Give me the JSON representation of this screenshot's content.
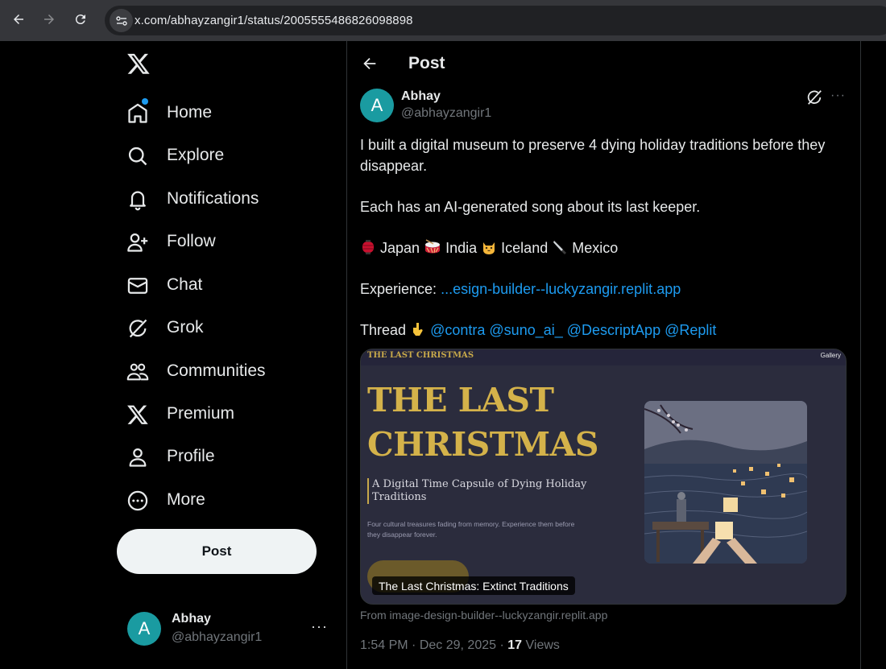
{
  "browser": {
    "url": "x.com/abhayzangir1/status/2005555486826098898"
  },
  "nav": {
    "items": [
      {
        "label": "Home",
        "icon": "home-icon"
      },
      {
        "label": "Explore",
        "icon": "search-icon"
      },
      {
        "label": "Notifications",
        "icon": "bell-icon"
      },
      {
        "label": "Follow",
        "icon": "person-add-icon"
      },
      {
        "label": "Chat",
        "icon": "envelope-icon"
      },
      {
        "label": "Grok",
        "icon": "grok-icon"
      },
      {
        "label": "Communities",
        "icon": "people-icon"
      },
      {
        "label": "Premium",
        "icon": "x-icon"
      },
      {
        "label": "Profile",
        "icon": "person-icon"
      },
      {
        "label": "More",
        "icon": "more-circle-icon"
      }
    ],
    "post_button": "Post"
  },
  "account": {
    "avatar_letter": "A",
    "name": "Abhay",
    "handle": "@abhayzangir1",
    "more": "···"
  },
  "header": {
    "title": "Post"
  },
  "tweet": {
    "avatar_letter": "A",
    "author_name": "Abhay",
    "author_handle": "@abhayzangir1",
    "more": "···",
    "line1": "I built a digital museum to preserve 4 dying holiday traditions before they",
    "line2": "disappear.",
    "line3": "Each has an AI-generated song about its last keeper.",
    "countries": {
      "japan": "Japan",
      "india": "India",
      "iceland": "Iceland",
      "mexico": "Mexico"
    },
    "experience_label": "Experience:",
    "experience_link": "...esign-builder--luckyzangir.replit.app",
    "thread_label": "Thread",
    "mentions": [
      "@contra",
      "@suno_ai_",
      "@DescriptApp",
      "@Replit"
    ],
    "card": {
      "top_title": "THE LAST CHRISTMAS",
      "gallery": "Gallery",
      "hero_line1": "THE LAST",
      "hero_line2": "CHRISTMAS",
      "subtitle": "A Digital Time Capsule of Dying Holiday Traditions",
      "description": "Four cultural treasures fading from memory. Experience them before they disappear forever.",
      "caption": "The Last Christmas: Extinct Traditions"
    },
    "from_text": "From image-design-builder--luckyzangir.replit.app",
    "time": "1:54 PM",
    "date": "Dec 29, 2025",
    "views_count": "17",
    "views_label": "Views"
  },
  "colors": {
    "accent": "#1d9bf0",
    "avatar": "#1a9ba1",
    "card_gold": "#d4b24a"
  }
}
